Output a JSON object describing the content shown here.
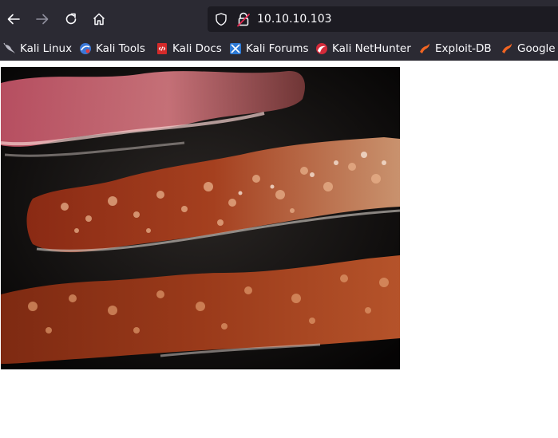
{
  "nav": {
    "back_icon": "arrow-left-icon",
    "forward_icon": "arrow-right-icon",
    "reload_icon": "reload-icon",
    "home_icon": "home-icon"
  },
  "urlbar": {
    "url": "10.10.10.103",
    "shield_icon": "tracking-protection-shield-icon",
    "lock_icon": "insecure-lock-icon"
  },
  "bookmarks": [
    {
      "label": "Kali Linux",
      "icon": "kali-dragon-icon"
    },
    {
      "label": "Kali Tools",
      "icon": "kali-tools-icon"
    },
    {
      "label": "Kali Docs",
      "icon": "kali-docs-icon"
    },
    {
      "label": "Kali Forums",
      "icon": "kali-forums-icon"
    },
    {
      "label": "Kali NetHunter",
      "icon": "kali-nethunter-icon"
    },
    {
      "label": "Exploit-DB",
      "icon": "exploit-db-icon"
    },
    {
      "label": "Google",
      "icon": "google-icon"
    }
  ],
  "content": {
    "image_subject": "bacon strips frying",
    "image_colors": {
      "background": "#0b0908",
      "bacon": "#8a2a14",
      "bacon_highlight": "#d98a5c",
      "bacon_fat": "#f2c9b0"
    }
  },
  "theme": {
    "toolbar_bg": "#2b2a33",
    "urlbar_bg": "#1c1b22",
    "text": "#fbfbfe"
  }
}
